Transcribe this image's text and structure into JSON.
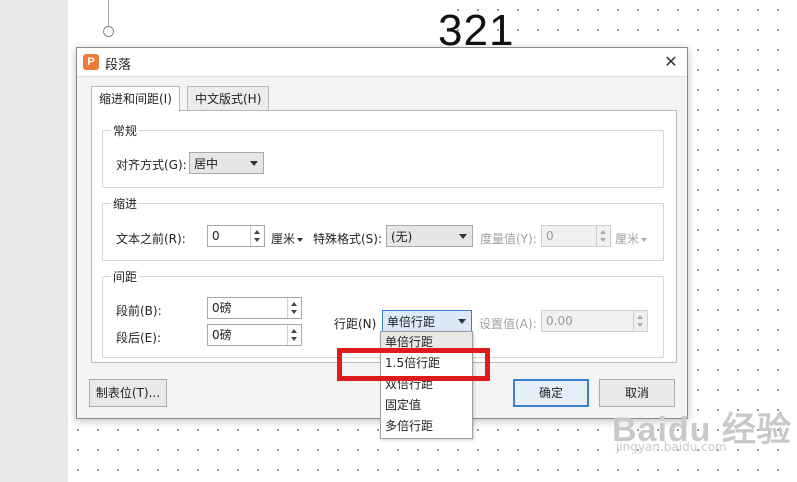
{
  "slide": {
    "number_text": "321"
  },
  "dialog": {
    "app_icon_text": "P",
    "title": "段落",
    "close_symbol": "✕",
    "tabs": [
      {
        "label": "缩进和间距(I)",
        "active": true
      },
      {
        "label": "中文版式(H)",
        "active": false
      }
    ],
    "general": {
      "legend": "常规",
      "alignment_label": "对齐方式(G):",
      "alignment_value": "居中"
    },
    "indent": {
      "legend": "缩进",
      "before_text_label": "文本之前(R):",
      "before_text_value": "0",
      "before_text_unit": "厘米",
      "special_label": "特殊格式(S):",
      "special_value": "(无)",
      "measure_label": "度量值(Y):",
      "measure_value": "0",
      "measure_unit": "厘米"
    },
    "spacing": {
      "legend": "间距",
      "before_label": "段前(B):",
      "before_value": "0磅",
      "after_label": "段后(E):",
      "after_value": "0磅",
      "line_spacing_label": "行距(N)",
      "line_spacing_value": "单倍行距",
      "setting_label": "设置值(A):",
      "setting_value": "0.00"
    },
    "buttons": {
      "tabs_label": "制表位(T)...",
      "ok_label": "确定",
      "cancel_label": "取消"
    }
  },
  "line_spacing_options": [
    {
      "label": "单倍行距",
      "selected": true
    },
    {
      "label": "1.5倍行距",
      "selected": false
    },
    {
      "label": "双倍行距",
      "selected": false
    },
    {
      "label": "固定值",
      "selected": false
    },
    {
      "label": "多倍行距",
      "selected": false
    }
  ],
  "annotation": {
    "color": "#e01b1b"
  },
  "watermark": {
    "text": "Baidu 经验",
    "sub": "jingyan.baidu.com"
  }
}
